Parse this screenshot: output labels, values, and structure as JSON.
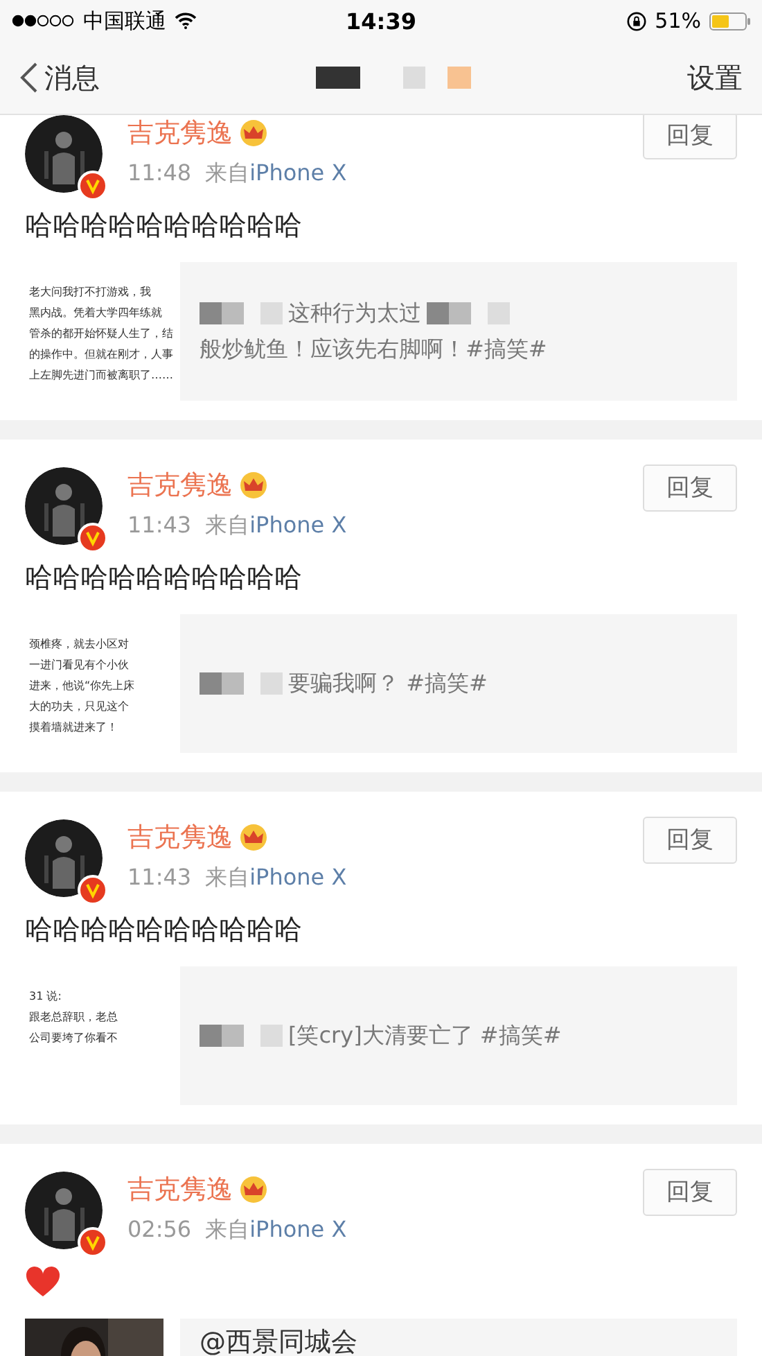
{
  "status_bar": {
    "carrier": "中国联通",
    "time": "14:39",
    "battery": "51%"
  },
  "nav": {
    "back": "消息",
    "action": "设置"
  },
  "posts": [
    {
      "author": "吉克隽逸",
      "time": "11:48",
      "source_prefix": "来自",
      "source": "iPhone X",
      "reply": "回复",
      "content": {
        "kind": "text",
        "text": "哈哈哈哈哈哈哈哈哈哈"
      },
      "quote": {
        "kind": "text_thumb",
        "thumb_lines": [
          "老大问我打不打游戏，我",
          "黑内战。凭着大学四年练就",
          "管杀的都开始怀疑人生了，结",
          "的操作中。但就在刚才，人事",
          "上左脚先进门而被离职了……"
        ],
        "parts": [
          {
            "kind": "mosaic"
          },
          {
            "kind": "text",
            "text": "这种行为太过"
          },
          {
            "kind": "mosaic"
          },
          {
            "kind": "text",
            "text": "般炒鱿鱼！应该先右脚啊！#搞笑#"
          }
        ]
      }
    },
    {
      "author": "吉克隽逸",
      "time": "11:43",
      "source_prefix": "来自",
      "source": "iPhone X",
      "reply": "回复",
      "content": {
        "kind": "text",
        "text": "哈哈哈哈哈哈哈哈哈哈"
      },
      "quote": {
        "kind": "text_thumb",
        "thumb_lines": [
          "颈椎疼，就去小区对",
          "一进门看见有个小伙",
          "进来，他说“你先上床",
          "大的功夫，只见这个",
          "摸着墙就进来了！"
        ],
        "parts": [
          {
            "kind": "mosaic"
          },
          {
            "kind": "text",
            "text": "要骗我啊？ #搞笑#"
          }
        ]
      }
    },
    {
      "author": "吉克隽逸",
      "time": "11:43",
      "source_prefix": "来自",
      "source": "iPhone X",
      "reply": "回复",
      "content": {
        "kind": "text",
        "text": "哈哈哈哈哈哈哈哈哈哈"
      },
      "quote": {
        "kind": "text_thumb",
        "thumb_lines": [
          "31 说:",
          "跟老总辞职，老总",
          "公司要垮了你看不"
        ],
        "parts": [
          {
            "kind": "mosaic"
          },
          {
            "kind": "text",
            "text": "[笑cry]大清要亡了 #搞笑#"
          }
        ]
      }
    },
    {
      "author": "吉克隽逸",
      "time": "02:56",
      "source_prefix": "来自",
      "source": "iPhone X",
      "reply": "回复",
      "content": {
        "kind": "heart"
      },
      "quote": {
        "kind": "picture",
        "parts": [
          {
            "kind": "text",
            "text": "@西景同城会"
          }
        ]
      }
    }
  ]
}
